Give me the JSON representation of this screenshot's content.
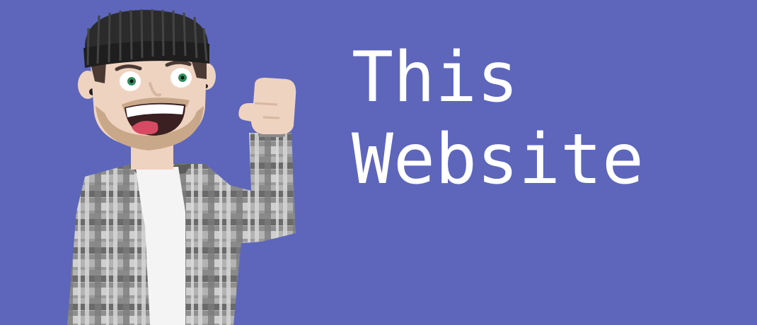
{
  "background_color": "#5d66bb",
  "headline": {
    "line1": "This",
    "line2": "Website"
  },
  "colors": {
    "text": "#ffffff",
    "beanie": "#2b2b2b",
    "skin": "#efd3c1",
    "beard": "#c9a88a",
    "hair": "#4a3a33",
    "eye_iris": "#2e8a5c",
    "mouth": "#3a2020",
    "tongue": "#d74a63",
    "shirt_base": "#b3b3b3",
    "shirt_dark": "#666666",
    "tshirt": "#f4f4f4"
  }
}
